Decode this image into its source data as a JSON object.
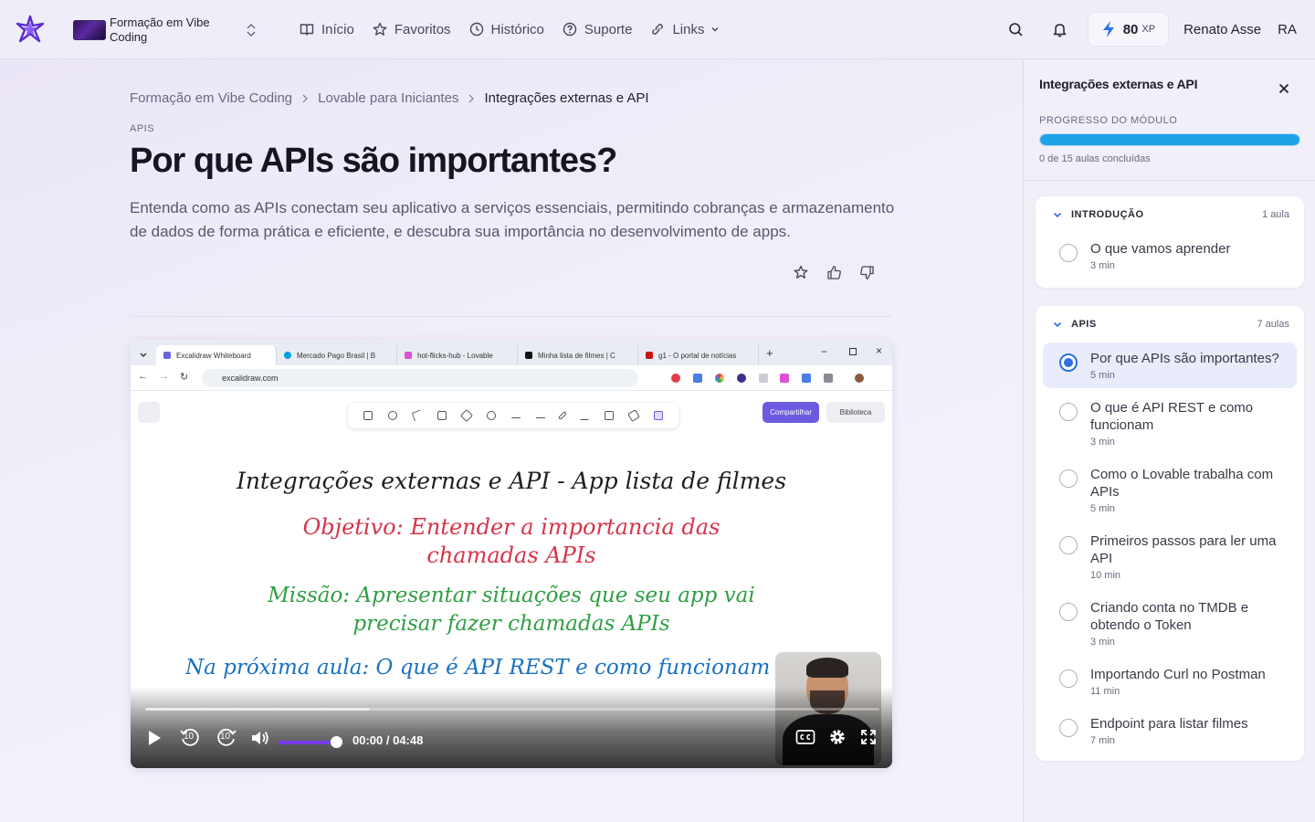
{
  "header": {
    "course_name": "Formação em Vibe Coding",
    "nav": [
      {
        "label": "Início",
        "icon": "book-icon"
      },
      {
        "label": "Favoritos",
        "icon": "star-icon"
      },
      {
        "label": "Histórico",
        "icon": "clock-icon"
      },
      {
        "label": "Suporte",
        "icon": "help-icon"
      },
      {
        "label": "Links",
        "icon": "link-icon"
      }
    ],
    "xp_value": "80",
    "xp_unit": "XP",
    "user_name": "Renato Asse",
    "user_initials": "RA"
  },
  "breadcrumb": [
    "Formação em Vibe Coding",
    "Lovable para Iniciantes",
    "Integrações externas e API"
  ],
  "lesson": {
    "eyebrow": "APIS",
    "title": "Por que APIs são importantes?",
    "description": "Entenda como as APIs conectam seu aplicativo a serviços essenciais, permitindo cobranças e armazenamento de dados de forma prática e eficiente, e descubra sua importância no desenvolvimento de apps."
  },
  "video": {
    "browser_tabs": [
      {
        "label": "Excalidraw Whiteboard",
        "color": "#6965db"
      },
      {
        "label": "Mercado Pago Brasil | B",
        "color": "#009ee3"
      },
      {
        "label": "hot-flicks-hub - Lovable",
        "color": "#e04ed8"
      },
      {
        "label": "Minha lista de filmes | C",
        "color": "#111111"
      },
      {
        "label": "g1 - O portal de notícias",
        "color": "#c4170c"
      }
    ],
    "url": "excalidraw.com",
    "share_label": "Compartilhar",
    "library_label": "Biblioteca",
    "board_title": "Integrações externas e API - App lista de filmes",
    "board_goal": "Objetivo: Entender a importancia das chamadas APIs",
    "board_mission": "Missão: Apresentar situações que seu app vai precisar fazer chamadas APIs",
    "board_next": "Na próxima aula: O que é API REST e como funcionam",
    "time_display": "00:00 / 04:48",
    "skip_seconds": "10"
  },
  "sidebar": {
    "title": "Integrações externas e API",
    "progress_label": "PROGRESSO DO MÓDULO",
    "progress_text": "0 de 15 aulas concluídas",
    "modules": [
      {
        "name": "INTRODUÇÃO",
        "count": "1 aula",
        "lessons": [
          {
            "title": "O que vamos aprender",
            "duration": "3 min",
            "active": false
          }
        ]
      },
      {
        "name": "APIS",
        "count": "7 aulas",
        "lessons": [
          {
            "title": "Por que APIs são importantes?",
            "duration": "5 min",
            "active": true
          },
          {
            "title": "O que é API REST e como funcionam",
            "duration": "3 min",
            "active": false
          },
          {
            "title": "Como o Lovable trabalha com APIs",
            "duration": "5 min",
            "active": false
          },
          {
            "title": "Primeiros passos para ler uma API",
            "duration": "10 min",
            "active": false
          },
          {
            "title": "Criando conta no TMDB e obtendo o Token",
            "duration": "3 min",
            "active": false
          },
          {
            "title": "Importando Curl no Postman",
            "duration": "11 min",
            "active": false
          },
          {
            "title": "Endpoint para listar filmes",
            "duration": "7 min",
            "active": false
          }
        ]
      }
    ]
  },
  "colors": {
    "accent": "#7c3aed",
    "progress": "#1fa3e8",
    "active_radio": "#2f6fe0"
  }
}
